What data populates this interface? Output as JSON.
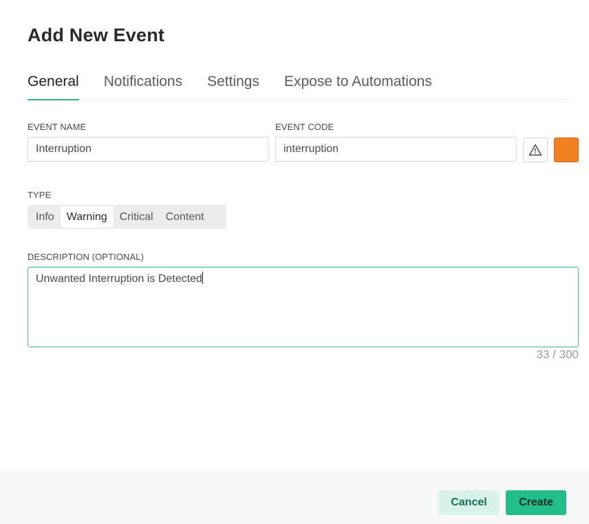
{
  "dialog": {
    "title": "Add New Event"
  },
  "tabs": [
    {
      "label": "General",
      "active": true
    },
    {
      "label": "Notifications",
      "active": false
    },
    {
      "label": "Settings",
      "active": false
    },
    {
      "label": "Expose to Automations",
      "active": false
    }
  ],
  "form": {
    "event_name": {
      "label": "EVENT NAME",
      "value": "Interruption"
    },
    "event_code": {
      "label": "EVENT CODE",
      "value": "interruption"
    },
    "icon": "warning-triangle-icon",
    "color": "#f08022",
    "type": {
      "label": "TYPE",
      "options": [
        "Info",
        "Warning",
        "Critical",
        "Content"
      ],
      "selected": "Warning"
    },
    "description": {
      "label": "DESCRIPTION (OPTIONAL)",
      "value": "Unwanted Interruption is Detected",
      "counter": "33 / 300"
    }
  },
  "footer": {
    "cancel_label": "Cancel",
    "create_label": "Create"
  },
  "colors": {
    "accent": "#2ab58a",
    "create_button": "#22bd8a",
    "cancel_button": "#daf3ea"
  }
}
